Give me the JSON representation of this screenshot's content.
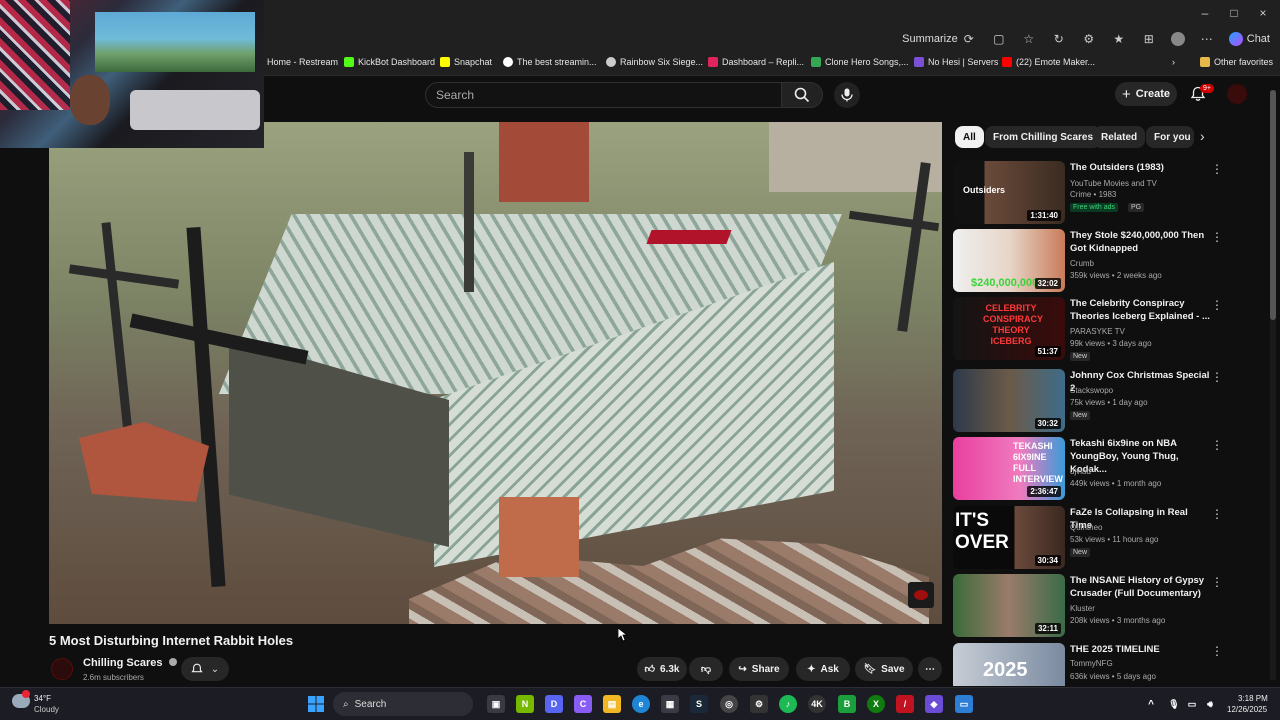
{
  "browser": {
    "summarize_label": "Summarize",
    "chat_label": "Chat",
    "window_controls": [
      "–",
      "□",
      "×"
    ]
  },
  "bookmarks": [
    {
      "label": "Home - Restream",
      "color": "#3a7bd5"
    },
    {
      "label": "KickBot Dashboard",
      "color": "#53fc18"
    },
    {
      "label": "Snapchat",
      "color": "#fffc00"
    },
    {
      "label": "The best streamin...",
      "color": "#ffffff"
    },
    {
      "label": "Rainbow Six Siege...",
      "color": "#cccccc"
    },
    {
      "label": "Dashboard – Repli...",
      "color": "#e0245e"
    },
    {
      "label": "Clone Hero Songs,...",
      "color": "#34a853"
    },
    {
      "label": "No Hesi | Servers",
      "color": "#7b4fd6"
    },
    {
      "label": "(22) Emote Maker...",
      "color": "#ff0000"
    }
  ],
  "other_favorites": "Other favorites",
  "youtube": {
    "search_placeholder": "Search",
    "create_label": "Create",
    "notif_count": "9+"
  },
  "video": {
    "title": "5 Most Disturbing Internet Rabbit Holes",
    "channel": "Chilling Scares",
    "subscribers": "2.6m subscribers",
    "likes": "6.3k",
    "share_label": "Share",
    "ask_label": "Ask",
    "save_label": "Save"
  },
  "chips": [
    "All",
    "From Chilling Scares",
    "Related",
    "For you"
  ],
  "recommendations": [
    {
      "title": "The Outsiders (1983)",
      "meta1": "YouTube Movies and TV",
      "meta2": "Crime • 1983",
      "badge": "Free with ads",
      "badge2": "PG",
      "duration": "1:31:40",
      "thumb_text": "Outsiders"
    },
    {
      "title": "They Stole $240,000,000 Then Got Kidnapped",
      "meta1": "Crumb",
      "meta2": "359k views • 2 weeks ago",
      "badge": "",
      "duration": "32:02",
      "thumb_text": "$240,000,000"
    },
    {
      "title": "The Celebrity Conspiracy Theories Iceberg Explained - ...",
      "meta1": "PARASYKE TV",
      "meta2": "99k views • 3 days ago",
      "badge": "New",
      "duration": "51:37",
      "thumb_text": "CELEBRITY CONSPIRACY THEORY ICEBERG"
    },
    {
      "title": "Johnny Cox Christmas Special 2",
      "meta1": "Stackswopo",
      "meta2": "75k views • 1 day ago",
      "badge": "New",
      "duration": "30:32",
      "thumb_text": ""
    },
    {
      "title": "Tekashi 6ix9ine on NBA YoungBoy, Young Thug, Kodak...",
      "meta1": "djvlad",
      "meta2": "449k views • 1 month ago",
      "badge": "",
      "duration": "2:36:47",
      "thumb_text": "TEKASHI 6IX9INE FULL INTERVIEW"
    },
    {
      "title": "FaZe Is Collapsing in Real Time",
      "meta1": "Quintheo",
      "meta2": "53k views • 11 hours ago",
      "badge": "New",
      "duration": "30:34",
      "thumb_text": "IT'S OVER"
    },
    {
      "title": "The INSANE History of Gypsy Crusader (Full Documentary)",
      "meta1": "Kluster",
      "meta2": "208k views • 3 months ago",
      "badge": "",
      "duration": "32:11",
      "thumb_text": ""
    },
    {
      "title": "THE 2025 TIMELINE",
      "meta1": "TommyNFG",
      "meta2": "636k views • 5 days ago",
      "badge": "",
      "duration": "",
      "thumb_text": "2025"
    }
  ],
  "taskbar": {
    "weather_temp": "34°F",
    "weather_desc": "Cloudy",
    "search_label": "Search",
    "time": "3:18 PM",
    "date": "12/26/2025"
  }
}
